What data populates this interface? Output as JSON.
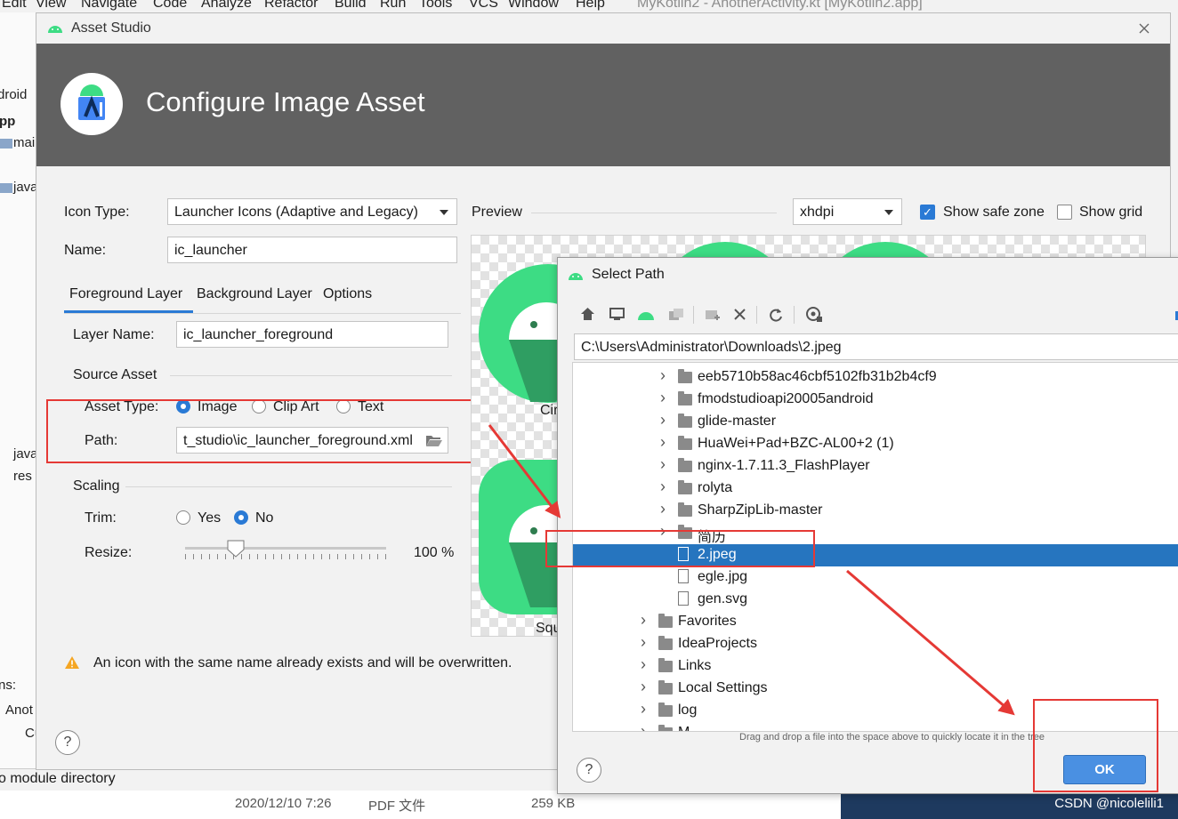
{
  "ide": {
    "menu": [
      "Edit",
      "View",
      "Navigate",
      "Code",
      "Analyze",
      "Refactor",
      "Build",
      "Run",
      "Tools",
      "VCS",
      "Window",
      "Help"
    ],
    "window_title": "MyKotlin2 - AnotherActivity.kt [MyKotlin2.app]",
    "sidebar": [
      "droid",
      "pp",
      "mai",
      "java",
      "java",
      "res",
      "ns:",
      "Anot",
      "Cu"
    ],
    "status_text": "o module directory",
    "file_row": {
      "date": "2020/12/10 7:26",
      "type": "PDF 文件",
      "size": "259 KB"
    },
    "watermark": "CSDN @nicolelili1"
  },
  "asset_studio": {
    "title": "Asset Studio",
    "header_title": "Configure Image Asset",
    "icon_type_label": "Icon Type:",
    "icon_type_value": "Launcher Icons (Adaptive and Legacy)",
    "name_label": "Name:",
    "name_value": "ic_launcher",
    "tabs": [
      "Foreground Layer",
      "Background Layer",
      "Options"
    ],
    "layer_name_label": "Layer Name:",
    "layer_name_value": "ic_launcher_foreground",
    "source_asset_label": "Source Asset",
    "asset_type_label": "Asset Type:",
    "asset_type_options": [
      "Image",
      "Clip Art",
      "Text"
    ],
    "path_label": "Path:",
    "path_value": "t_studio\\ic_launcher_foreground.xml",
    "scaling_label": "Scaling",
    "trim_label": "Trim:",
    "trim_options": [
      "Yes",
      "No"
    ],
    "resize_label": "Resize:",
    "resize_value": "100 %",
    "resize_fraction": 1.0,
    "preview_label": "Preview",
    "density_value": "xhdpi",
    "show_safe_zone_label": "Show safe zone",
    "show_grid_label": "Show grid",
    "preview_captions": [
      "Cir",
      "Squ"
    ],
    "warning": "An icon with the same name already exists and will be overwritten.",
    "help": "?"
  },
  "select_path": {
    "title": "Select Path",
    "path_value": "C:\\Users\\Administrator\\Downloads\\2.jpeg",
    "tree": [
      {
        "name": "eeb5710b58ac46cbf5102fb31b2b4cf9",
        "type": "folder",
        "expandable": true,
        "depth": 1
      },
      {
        "name": "fmodstudioapi20005android",
        "type": "folder",
        "expandable": true,
        "depth": 1
      },
      {
        "name": "glide-master",
        "type": "folder",
        "expandable": true,
        "depth": 1
      },
      {
        "name": "HuaWei+Pad+BZC-AL00+2 (1)",
        "type": "folder",
        "expandable": true,
        "depth": 1
      },
      {
        "name": "nginx-1.7.11.3_FlashPlayer",
        "type": "folder",
        "expandable": true,
        "depth": 1
      },
      {
        "name": "rolyta",
        "type": "folder",
        "expandable": true,
        "depth": 1
      },
      {
        "name": "SharpZipLib-master",
        "type": "folder",
        "expandable": true,
        "depth": 1
      },
      {
        "name": "简历",
        "type": "folder",
        "expandable": true,
        "depth": 1
      },
      {
        "name": "2.jpeg",
        "type": "file",
        "expandable": false,
        "depth": 1,
        "selected": true
      },
      {
        "name": "egle.jpg",
        "type": "file",
        "expandable": false,
        "depth": 1
      },
      {
        "name": "gen.svg",
        "type": "file",
        "expandable": false,
        "depth": 1
      },
      {
        "name": "Favorites",
        "type": "folder",
        "expandable": true,
        "depth": 0
      },
      {
        "name": "IdeaProjects",
        "type": "folder",
        "expandable": true,
        "depth": 0
      },
      {
        "name": "Links",
        "type": "folder",
        "expandable": true,
        "depth": 0
      },
      {
        "name": "Local Settings",
        "type": "folder",
        "expandable": true,
        "depth": 0
      },
      {
        "name": "log",
        "type": "folder",
        "expandable": true,
        "depth": 0
      },
      {
        "name": "M...",
        "type": "folder",
        "expandable": true,
        "depth": 0
      }
    ],
    "hint": "Drag and drop a file into the space above to quickly locate it in the tree",
    "ok_label": "OK",
    "help": "?"
  },
  "colors": {
    "accent": "#2a7ad5",
    "selection": "#2675bf",
    "header": "#616161",
    "annotation": "#e53935",
    "android_green": "#3ddc84"
  }
}
